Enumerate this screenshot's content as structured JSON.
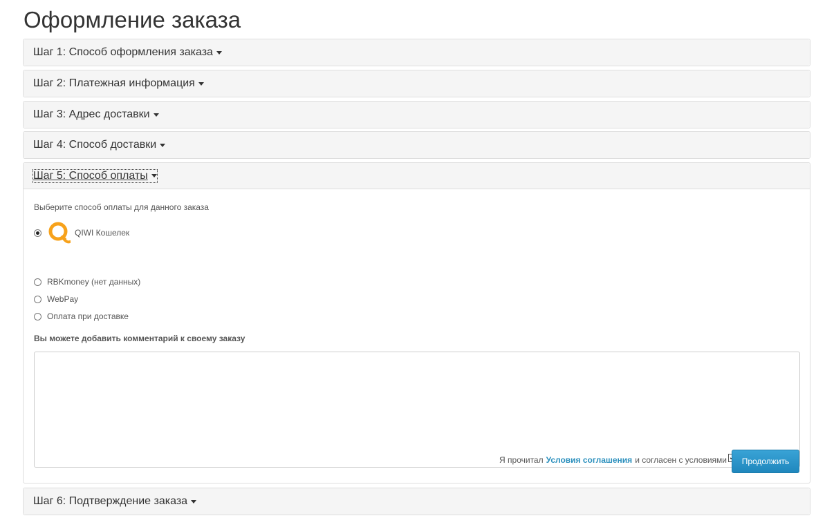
{
  "page": {
    "title": "Оформление заказа"
  },
  "steps": [
    {
      "label": "Шаг 1: Способ оформления заказа"
    },
    {
      "label": "Шаг 2: Платежная информация"
    },
    {
      "label": "Шаг 3: Адрес доставки"
    },
    {
      "label": "Шаг 4: Способ доставки"
    },
    {
      "label": "Шаг 5: Способ оплаты"
    },
    {
      "label": "Шаг 6: Подтверждение заказа"
    }
  ],
  "payment": {
    "hint": "Выберите способ оплаты для данного заказа",
    "options": [
      {
        "label": "QIWI Кошелек",
        "selected": true,
        "icon": "qiwi-logo-icon"
      },
      {
        "label": "RBKmoney (нет данных)",
        "selected": false
      },
      {
        "label": "WebPay",
        "selected": false
      },
      {
        "label": "Оплата при доставке",
        "selected": false
      }
    ],
    "comment_label": "Вы можете добавить комментарий к своему заказу",
    "comment_value": "",
    "agree_prefix": "Я прочитал",
    "agree_link": "Условия соглашения",
    "agree_suffix": "и согласен с условиями",
    "agree_checked": true,
    "continue_label": "Продолжить"
  },
  "colors": {
    "accent": "#2a8fbd",
    "button": "#2a93c9",
    "qiwi": "#f7a21b"
  }
}
